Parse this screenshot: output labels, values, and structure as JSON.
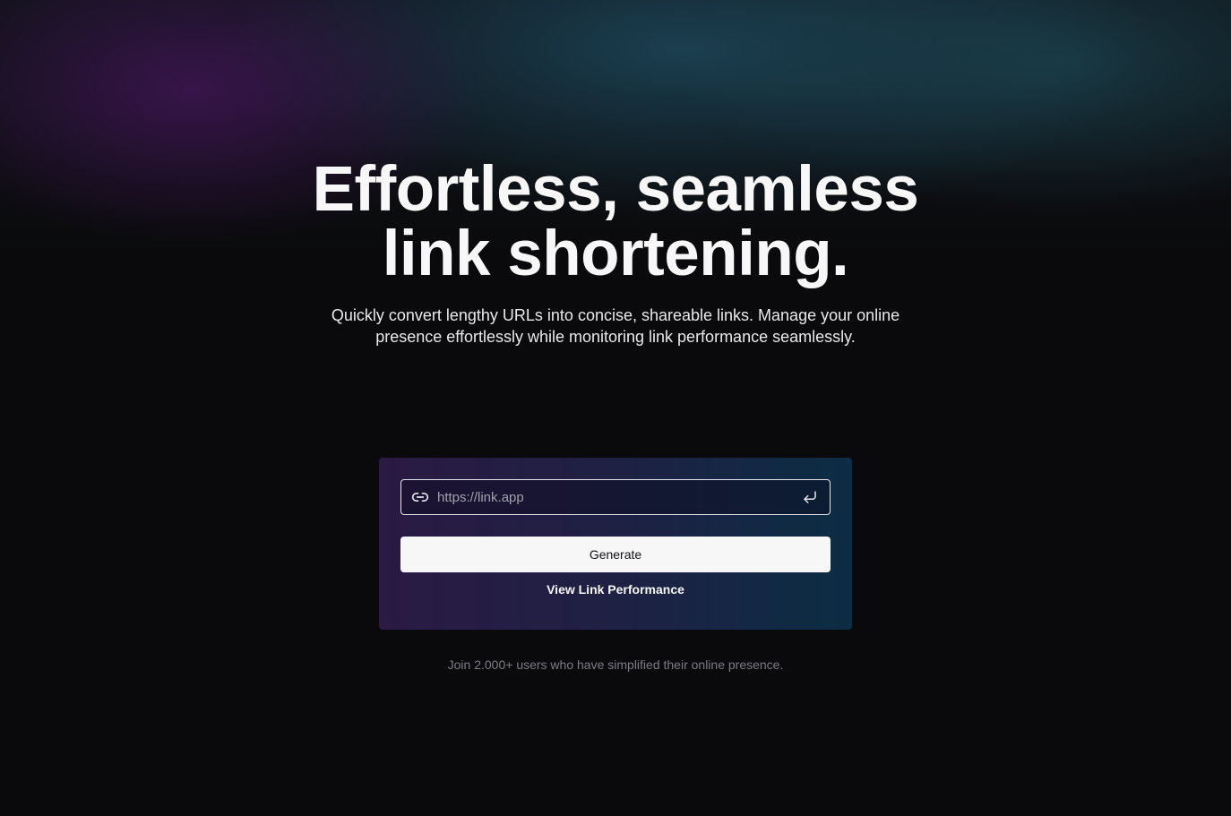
{
  "hero": {
    "headline_line1": "Effortless, seamless",
    "headline_line2": "link shortening.",
    "subtitle": "Quickly convert lengthy URLs into concise, shareable links. Manage your online presence effortlessly while monitoring link performance seamlessly."
  },
  "form": {
    "url_placeholder": "https://link.app",
    "url_value": "",
    "generate_label": "Generate",
    "performance_link_label": "View Link Performance",
    "link_icon": "link-icon",
    "submit_icon": "enter-return-icon"
  },
  "footer": {
    "social_proof": "Join 2.000+ users who have simplified their online presence."
  },
  "colors": {
    "background": "#0a0a0c",
    "card_gradient_start": "#2a1a44",
    "card_gradient_end": "#0c2d44",
    "button_bg": "#f7f7f8",
    "muted_text": "#7b7b85"
  }
}
